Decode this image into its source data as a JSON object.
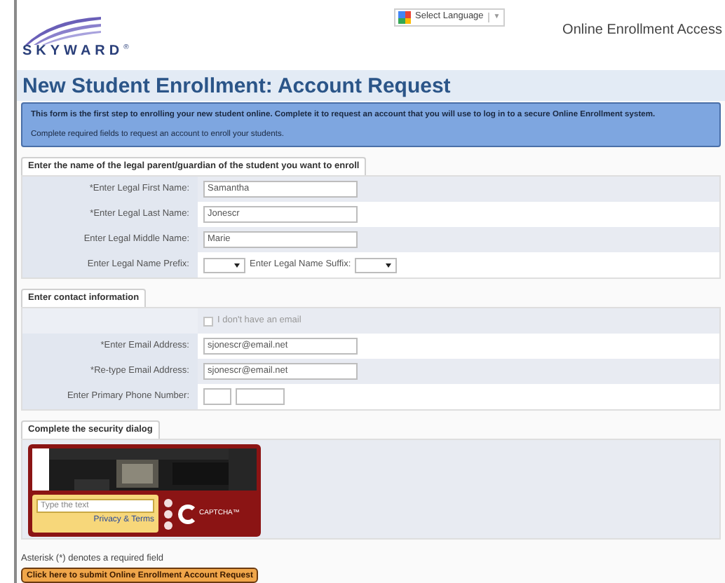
{
  "header": {
    "logo_text": "SKYWARD",
    "logo_mark": "®",
    "language_button": "Select Language",
    "language_caret": "▼",
    "app_title": "Online Enrollment Access"
  },
  "page_title": "New Student Enrollment: Account Request",
  "info": [
    "This form is the first step to enrolling your new student online. Complete it to request an account that you will use to log in to a secure Online Enrollment system.",
    "Complete required fields to request an account to enroll your students."
  ],
  "sections": [
    {
      "title": "Enter the name of the legal parent/guardian of the student you want to enroll",
      "rows": [
        {
          "kind": "text",
          "label": "*Enter Legal First Name:",
          "value": "Samantha"
        },
        {
          "kind": "text",
          "label": "*Enter Legal Last Name:",
          "value": "Jonescr"
        },
        {
          "kind": "text",
          "label": "Enter Legal Middle Name:",
          "value": "Marie"
        },
        {
          "kind": "select_pair",
          "label": "Enter Legal Name Prefix:",
          "label_2": "Enter Legal Name Suffix:"
        }
      ]
    },
    {
      "title": "Enter contact information",
      "rows": [
        {
          "kind": "checkbox",
          "label": "I don't have an email",
          "checked": false,
          "disabled": true
        },
        {
          "kind": "text",
          "label": "*Enter Email Address:",
          "value": "sjonescr@email.net"
        },
        {
          "kind": "text",
          "label": "*Re-type Email Address:",
          "value": "sjonescr@email.net"
        },
        {
          "kind": "phone",
          "label": "Enter Primary Phone Number:"
        }
      ]
    },
    {
      "title": "Complete the security dialog",
      "captcha": {
        "placeholder": "Type the text",
        "link": "Privacy & Terms",
        "logo_text": "CAPTCHA™"
      }
    }
  ],
  "footnote": "Asterisk (*) denotes a required field",
  "submit_button": "Click here to submit Online Enrollment Account Request"
}
